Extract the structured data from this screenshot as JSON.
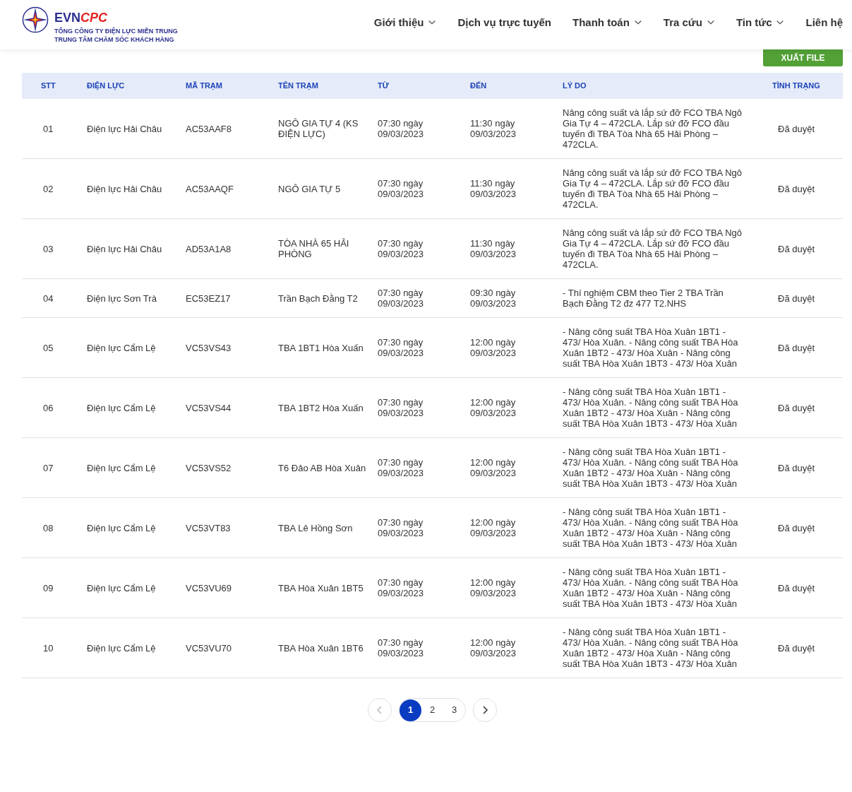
{
  "header": {
    "logo": {
      "brand_1": "EVN",
      "brand_2": "CPC",
      "subtitle_1": "TỔNG CÔNG TY ĐIỆN LỰC MIỀN TRUNG",
      "subtitle_2": "TRUNG TÂM CHĂM SÓC KHÁCH HÀNG"
    },
    "nav": [
      {
        "label": "Giới thiệu",
        "kind": "dropdown"
      },
      {
        "label": "Dịch vụ trực tuyến",
        "kind": "link"
      },
      {
        "label": "Thanh toán",
        "kind": "dropdown"
      },
      {
        "label": "Tra cứu",
        "kind": "dropdown"
      },
      {
        "label": "Tin tức",
        "kind": "dropdown"
      },
      {
        "label": "Liên hệ",
        "kind": "link"
      }
    ]
  },
  "export_button": "XUẤT FILE",
  "table": {
    "columns": [
      "STT",
      "ĐIỆN LỰC",
      "MÃ TRẠM",
      "TÊN TRẠM",
      "TỪ",
      "ĐẾN",
      "LÝ DO",
      "TÌNH TRẠNG"
    ],
    "rows": [
      [
        "01",
        "Điện lực Hải Châu",
        "AC53AAF8",
        "NGÔ GIA TỰ 4 (KS ĐIỆN LỰC)",
        "07:30 ngày 09/03/2023",
        "11:30 ngày 09/03/2023",
        "Nâng công suất và lắp sứ đỡ FCO TBA Ngô Gia Tự 4 – 472CLA. Lắp sứ đỡ FCO đầu tuyến đi TBA Tòa Nhà 65 Hải Phòng – 472CLA.",
        "Đã duyệt"
      ],
      [
        "02",
        "Điện lực Hải Châu",
        "AC53AAQF",
        "NGÔ GIA TỰ 5",
        "07:30 ngày 09/03/2023",
        "11:30 ngày 09/03/2023",
        "Nâng công suất và lắp sứ đỡ FCO TBA Ngô Gia Tự 4 – 472CLA. Lắp sứ đỡ FCO đầu tuyến đi TBA Tòa Nhà 65 Hải Phòng – 472CLA.",
        "Đã duyệt"
      ],
      [
        "03",
        "Điện lực Hải Châu",
        "AD53A1A8",
        "TÒA NHÀ 65 HẢI PHÒNG",
        "07:30 ngày 09/03/2023",
        "11:30 ngày 09/03/2023",
        "Nâng công suất và lắp sứ đỡ FCO TBA Ngô Gia Tự 4 – 472CLA. Lắp sứ đỡ FCO đầu tuyến đi TBA Tòa Nhà 65 Hải Phòng – 472CLA.",
        "Đã duyệt"
      ],
      [
        "04",
        "Điện lực Sơn Trà",
        "EC53EZ17",
        "Trần Bạch Đằng T2",
        "07:30 ngày 09/03/2023",
        "09:30 ngày 09/03/2023",
        "- Thí nghiệm CBM theo Tier 2 TBA Trần Bạch Đằng T2 đz 477 T2.NHS",
        "Đã duyệt"
      ],
      [
        "05",
        "Điện lực Cẩm Lệ",
        "VC53VS43",
        "TBA 1BT1 Hòa Xuấn",
        "07:30 ngày 09/03/2023",
        "12:00 ngày 09/03/2023",
        "- Nâng công suất TBA Hòa Xuân 1BT1 - 473/ Hòa Xuân. - Nâng công suất TBA Hòa Xuân 1BT2 - 473/ Hòa Xuân - Nâng công suất TBA Hòa Xuân 1BT3 - 473/ Hòa Xuân",
        "Đã duyệt"
      ],
      [
        "06",
        "Điện lực Cẩm Lệ",
        "VC53VS44",
        "TBA 1BT2 Hòa Xuấn",
        "07:30 ngày 09/03/2023",
        "12:00 ngày 09/03/2023",
        "- Nâng công suất TBA Hòa Xuân 1BT1 - 473/ Hòa Xuân. - Nâng công suất TBA Hòa Xuân 1BT2 - 473/ Hòa Xuân - Nâng công suất TBA Hòa Xuân 1BT3 - 473/ Hòa Xuân",
        "Đã duyệt"
      ],
      [
        "07",
        "Điện lực Cẩm Lệ",
        "VC53VS52",
        "T6 Đảo AB Hòa Xuân",
        "07:30 ngày 09/03/2023",
        "12:00 ngày 09/03/2023",
        "- Nâng công suất TBA Hòa Xuân 1BT1 - 473/ Hòa Xuân. - Nâng công suất TBA Hòa Xuân 1BT2 - 473/ Hòa Xuân - Nâng công suất TBA Hòa Xuân 1BT3 - 473/ Hòa Xuân",
        "Đã duyệt"
      ],
      [
        "08",
        "Điện lực Cẩm Lệ",
        "VC53VT83",
        "TBA Lê Hồng Sơn",
        "07:30 ngày 09/03/2023",
        "12:00 ngày 09/03/2023",
        "- Nâng công suất TBA Hòa Xuân 1BT1 - 473/ Hòa Xuân. - Nâng công suất TBA Hòa Xuân 1BT2 - 473/ Hòa Xuân - Nâng công suất TBA Hòa Xuân 1BT3 - 473/ Hòa Xuân",
        "Đã duyệt"
      ],
      [
        "09",
        "Điện lực Cẩm Lệ",
        "VC53VU69",
        "TBA Hòa Xuân 1BT5",
        "07:30 ngày 09/03/2023",
        "12:00 ngày 09/03/2023",
        "- Nâng công suất TBA Hòa Xuân 1BT1 - 473/ Hòa Xuân. - Nâng công suất TBA Hòa Xuân 1BT2 - 473/ Hòa Xuân - Nâng công suất TBA Hòa Xuân 1BT3 - 473/ Hòa Xuân",
        "Đã duyệt"
      ],
      [
        "10",
        "Điện lực Cẩm Lệ",
        "VC53VU70",
        "TBA Hòa Xuân 1BT6",
        "07:30 ngày 09/03/2023",
        "12:00 ngày 09/03/2023",
        "- Nâng công suất TBA Hòa Xuân 1BT1 - 473/ Hòa Xuân. - Nâng công suất TBA Hòa Xuân 1BT2 - 473/ Hòa Xuân - Nâng công suất TBA Hòa Xuân 1BT3 - 473/ Hòa Xuân",
        "Đã duyệt"
      ]
    ]
  },
  "pagination": {
    "previous": {
      "disabled": true
    },
    "next": {
      "disabled": false
    },
    "pages": [
      {
        "label": "1",
        "selected": true
      },
      {
        "label": "2",
        "selected": false
      },
      {
        "label": "3",
        "selected": false
      }
    ]
  }
}
